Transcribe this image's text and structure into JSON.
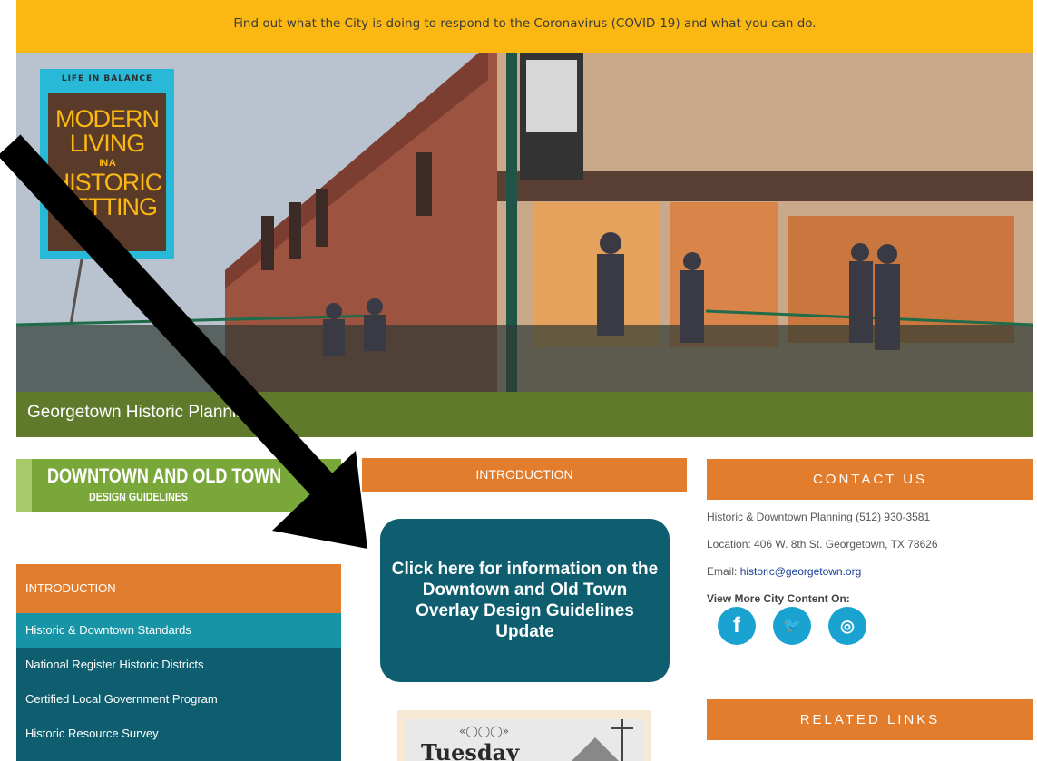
{
  "covid_banner": {
    "text": "Find out what the City is doing to respond to the Coronavirus (COVID-19) and what you can do."
  },
  "hero": {
    "logo": {
      "tagline": "LIFE IN BALANCE",
      "line1": "MODERN",
      "line2": "LIVING",
      "line3": "IN A",
      "line4": "HISTORIC",
      "line5": "SETTING"
    }
  },
  "page_title": "Georgetown Historic Planning",
  "guidelines_banner": {
    "title": "DOWNTOWN AND OLD TOWN",
    "subtitle": "DESIGN GUIDELINES"
  },
  "sidebar": {
    "items": [
      {
        "label": "INTRODUCTION"
      },
      {
        "label": "Historic & Downtown Standards"
      },
      {
        "label": "National Register Historic Districts"
      },
      {
        "label": "Certified Local Government Program"
      },
      {
        "label": "Historic Resource Survey"
      }
    ]
  },
  "main": {
    "heading": "INTRODUCTION",
    "cta_button": "Click here for information on the Downtown and Old Town Overlay Design Guidelines Update",
    "flyer": {
      "ornament": "«◯◯◯»",
      "text": "Tuesday"
    }
  },
  "contact": {
    "heading": "CONTACT US",
    "phone_line": "Historic & Downtown Planning (512) 930-3581",
    "location_line": "Location: 406 W. 8th St. Georgetown, TX 78626",
    "email_label": "Email: ",
    "email": "historic@georgetown.org",
    "view_more": "View More City Content On:",
    "social": [
      {
        "icon": "facebook-icon",
        "glyph": "f"
      },
      {
        "icon": "twitter-icon",
        "glyph": "🐦"
      },
      {
        "icon": "instagram-icon",
        "glyph": "◎"
      }
    ]
  },
  "related": {
    "heading": "RELATED LINKS"
  },
  "colors": {
    "accent_orange": "#e27d2e",
    "teal": "#0e5e6f",
    "banner_yellow": "#fbb813",
    "band_green": "#5f7a2b"
  }
}
